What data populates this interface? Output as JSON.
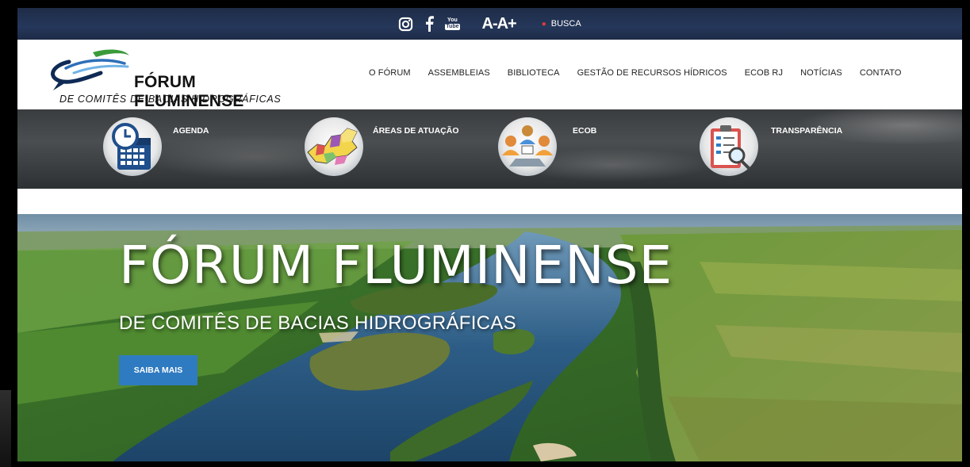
{
  "topbar": {
    "icons": [
      "instagram-icon",
      "facebook-icon",
      "youtube-icon"
    ],
    "youtube_label_top": "You",
    "youtube_label_bottom": "Tube",
    "font_decrease": "A-",
    "font_increase": "A+",
    "search_label": "BUSCA"
  },
  "logo": {
    "title": "FÓRUM FLUMINENSE",
    "subtitle": "DE COMITÊS DE BACIAS HIDROGRÁFICAS"
  },
  "nav": {
    "items": [
      {
        "label": "O FÓRUM"
      },
      {
        "label": "ASSEMBLEIAS"
      },
      {
        "label": "BIBLIOTECA"
      },
      {
        "label": "GESTÃO DE RECURSOS HÍDRICOS"
      },
      {
        "label": "ECOB RJ"
      },
      {
        "label": "NOTÍCIAS"
      },
      {
        "label": "CONTATO"
      }
    ]
  },
  "features": [
    {
      "label": "AGENDA",
      "icon": "calendar-clock-icon"
    },
    {
      "label": "ÁREAS DE ATUAÇÃO",
      "icon": "map-icon"
    },
    {
      "label": "ECOB",
      "icon": "meeting-icon"
    },
    {
      "label": "TRANSPARÊNCIA",
      "icon": "clipboard-search-icon"
    }
  ],
  "hero": {
    "title": "FÓRUM FLUMINENSE",
    "subtitle": "DE COMITÊS DE BACIAS HIDROGRÁFICAS",
    "button": "SAIBA MAIS"
  },
  "colors": {
    "topbar": "#22345a",
    "button": "#2f7bc1",
    "search_dot": "#e23b3b"
  }
}
